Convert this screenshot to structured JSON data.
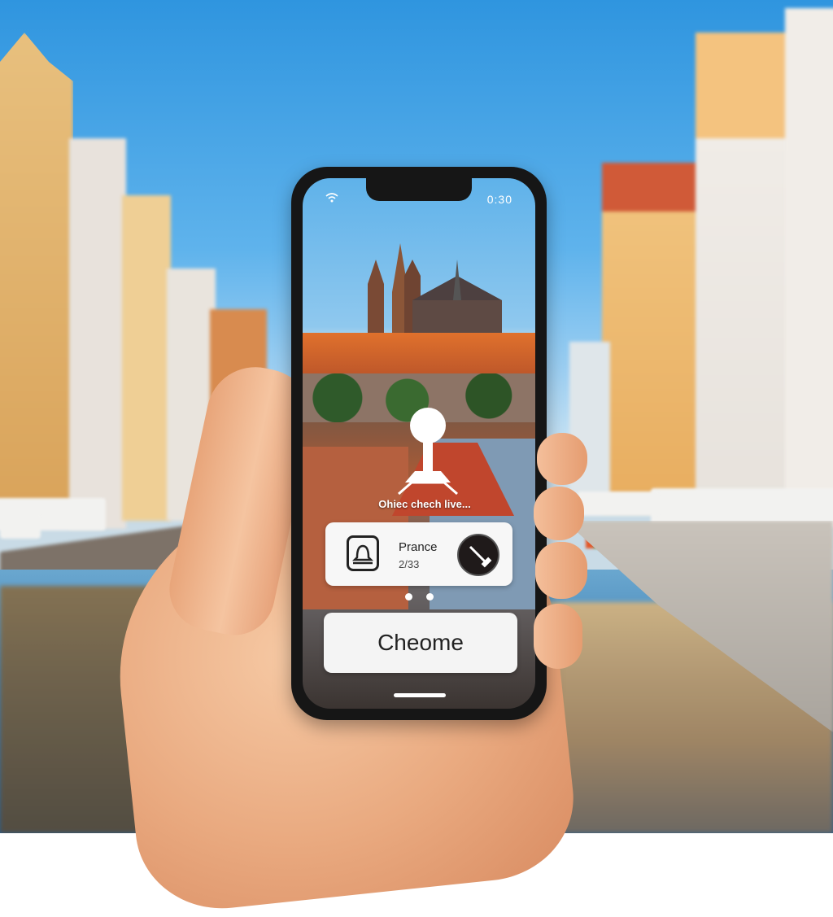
{
  "status_bar": {
    "left_icon": "wifi-icon",
    "time": "0:30"
  },
  "map_pin": {
    "icon": "map-pin-icon",
    "label": "Ohiec chech live..."
  },
  "info_card": {
    "icon": "bell-icon",
    "title": "Prance",
    "subtitle": "2/33",
    "action_icon": "hammer-icon"
  },
  "pager": {
    "count": 2,
    "active_index": 0
  },
  "primary_button": {
    "label": "Cheome"
  },
  "colors": {
    "sky_top": "#2f95df",
    "card_bg": "#f7f7f7",
    "button_bg": "#f4f4f4",
    "phone_frame": "#161616"
  }
}
